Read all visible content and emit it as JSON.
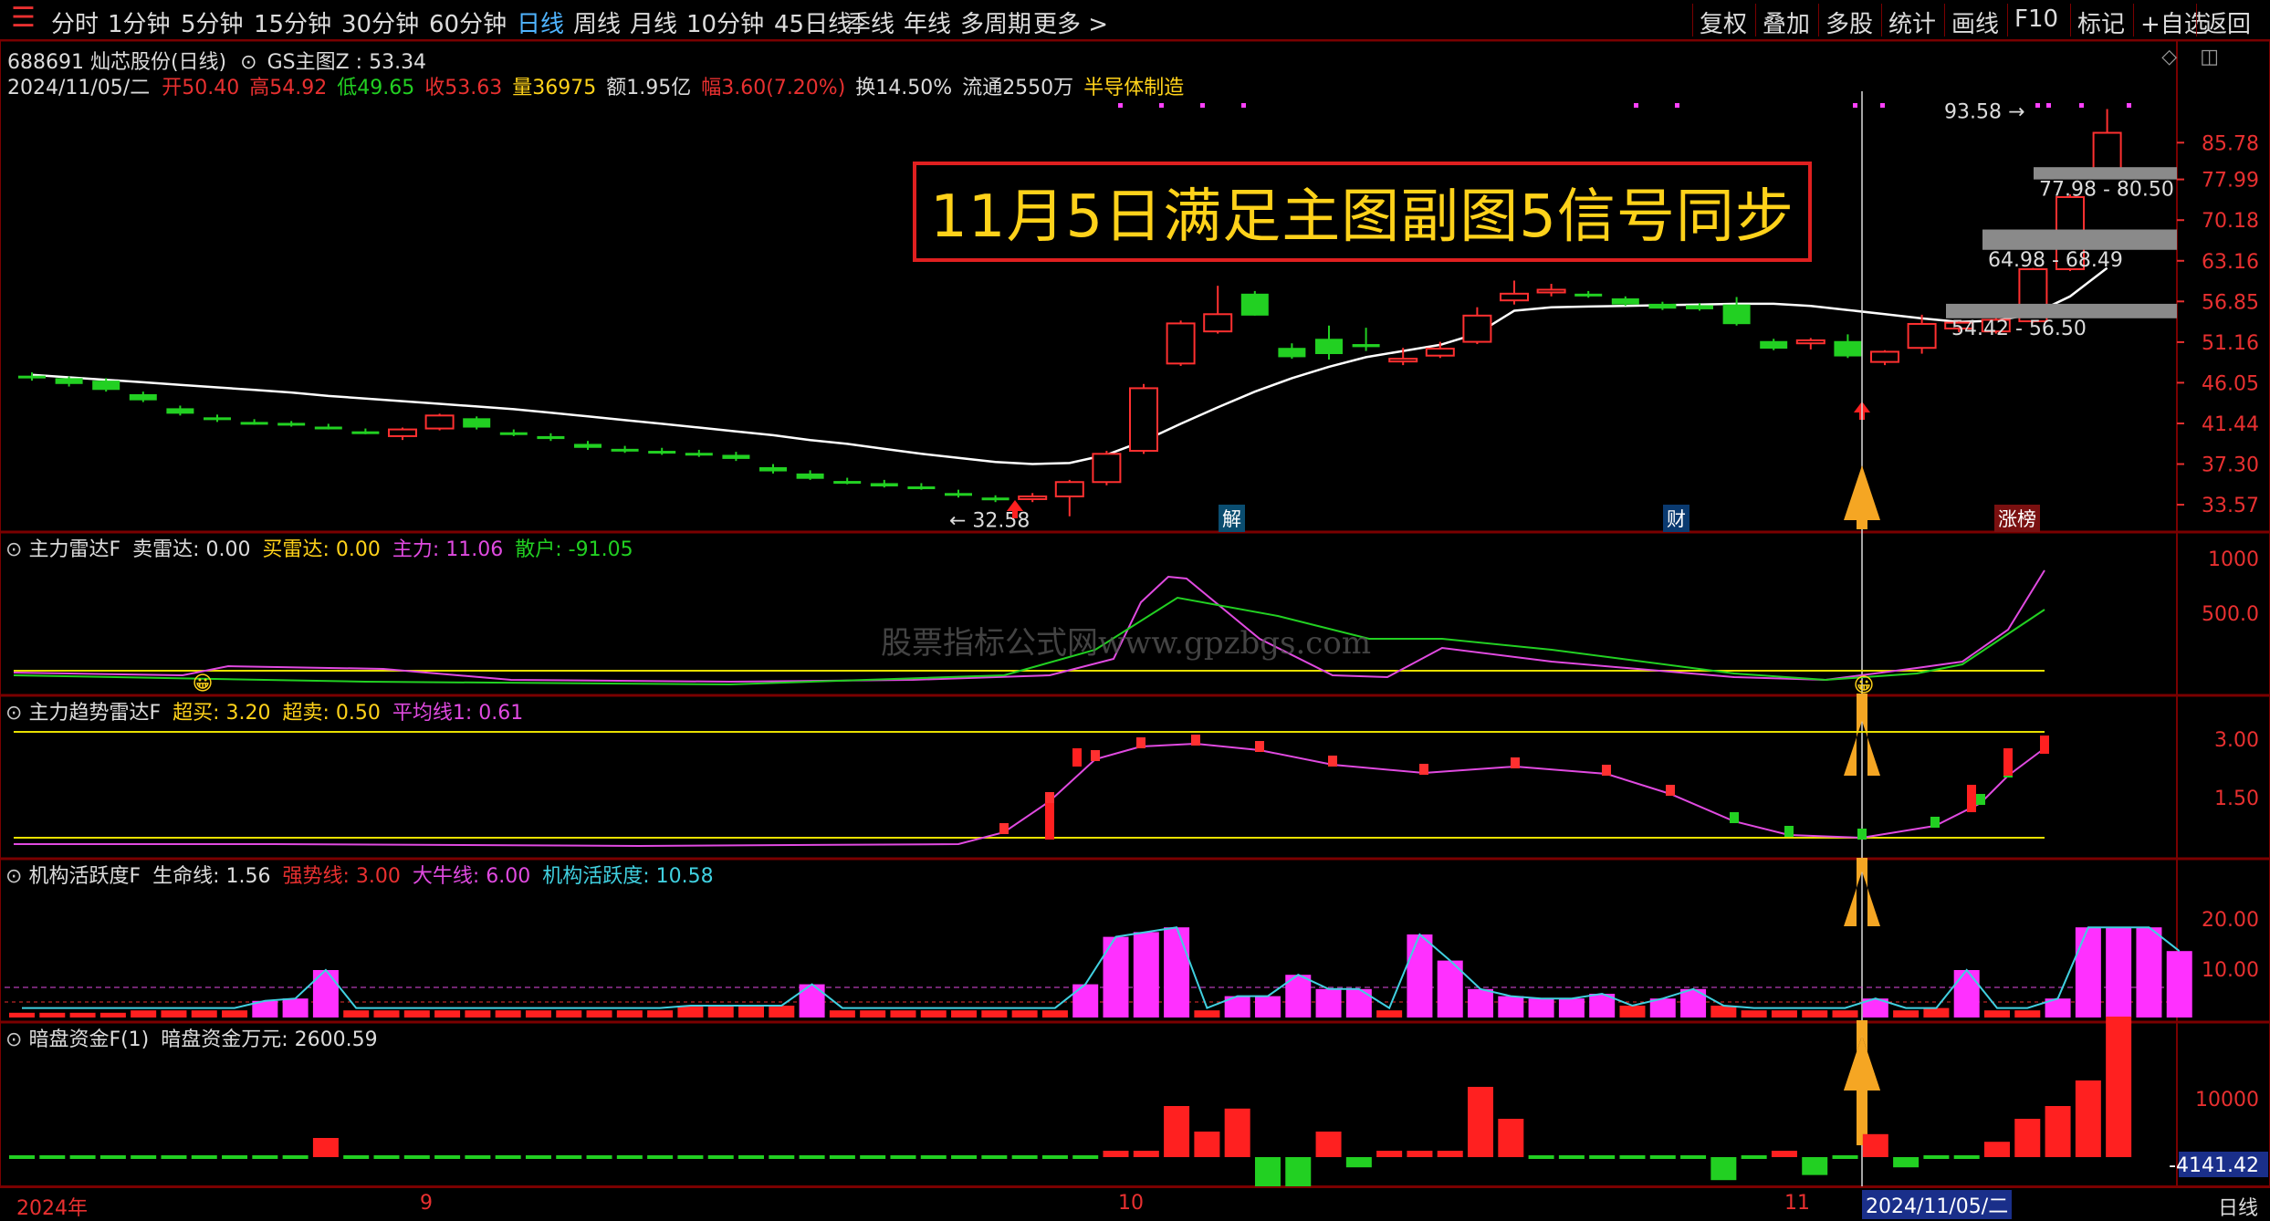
{
  "toolbar": {
    "periods": [
      "分时",
      "1分钟",
      "5分钟",
      "15分钟",
      "30分钟",
      "60分钟",
      "日线",
      "周线",
      "月线",
      "10分钟",
      "45日线",
      "季线",
      "年线",
      "多周期",
      "更多 >"
    ],
    "active": "日线",
    "right_buttons": [
      "复权",
      "叠加",
      "多股",
      "统计",
      "画线",
      "F10",
      "标记",
      "+自选",
      "返回"
    ]
  },
  "stock": {
    "header_line1": "688691 灿芯股份(日线)",
    "indicator": "GS主图Z : 53.34",
    "date": "2024/11/05/二",
    "open_label": "开",
    "open": "50.40",
    "high_label": "高",
    "high": "54.92",
    "low_label": "低",
    "low": "49.65",
    "close_label": "收",
    "close": "53.63",
    "vol_label": "量",
    "vol": "36975",
    "amt": "额1.95亿",
    "range_label": "幅",
    "range": "3.60(7.20%)",
    "turnover": "换14.50%",
    "float": "流通2550万",
    "industry": "半导体制造"
  },
  "annotation": {
    "title": "11月5日满足主图副图5信号同步",
    "low_price": "32.58",
    "high_price": "93.58",
    "zones": [
      "77.98 - 80.50",
      "64.98 - 68.49",
      "54.42 - 56.50"
    ],
    "badges": [
      "解",
      "财",
      "涨榜"
    ]
  },
  "price_axis": [
    "85.78",
    "77.99",
    "70.18",
    "63.16",
    "56.85",
    "51.16",
    "46.05",
    "41.44",
    "37.30",
    "33.57"
  ],
  "panels": {
    "p1": {
      "name": "主力雷达F",
      "l1": "卖雷达: 0.00",
      "l2": "买雷达: 0.00",
      "l3": "主力: 11.06",
      "l4": "散户: -91.05",
      "axis": [
        "1000",
        "500.0"
      ]
    },
    "p2": {
      "name": "主力趋势雷达F",
      "l1": "超买: 3.20",
      "l2": "超卖: 0.50",
      "l3": "平均线1: 0.61",
      "axis": [
        "3.00",
        "1.50"
      ]
    },
    "p3": {
      "name": "机构活跃度F",
      "l1": "生命线: 1.56",
      "l2": "强势线: 3.00",
      "l3": "大牛线: 6.00",
      "l4": "机构活跃度: 10.58",
      "axis": [
        "20.00",
        "10.00"
      ]
    },
    "p4": {
      "name": "暗盘资金F(1)",
      "l1": "暗盘资金万元: 2600.59",
      "axis": [
        "10000",
        "-4141.42"
      ]
    }
  },
  "watermark": "股票指标公式网www.gpzbgs.com",
  "dates": {
    "d1": "2024年",
    "d2": "9",
    "d3": "10",
    "d4": "11",
    "d5": "2024/11/05/二",
    "period": "日线"
  },
  "chart_data": {
    "type": "candlestick",
    "candles": [
      [
        46.9,
        47.3,
        46.3,
        46.6
      ],
      [
        46.6,
        46.8,
        45.6,
        45.9
      ],
      [
        46.3,
        46.6,
        45.0,
        45.2
      ],
      [
        44.7,
        45.0,
        43.8,
        44.0
      ],
      [
        43.1,
        43.4,
        42.3,
        42.5
      ],
      [
        42.1,
        42.4,
        41.6,
        41.8
      ],
      [
        41.6,
        41.9,
        41.3,
        41.5
      ],
      [
        41.5,
        41.7,
        41.1,
        41.3
      ],
      [
        41.1,
        41.4,
        40.8,
        41.0
      ],
      [
        40.6,
        40.9,
        40.3,
        40.5
      ],
      [
        40.1,
        41.0,
        39.7,
        40.8
      ],
      [
        40.9,
        42.5,
        40.7,
        42.3
      ],
      [
        42.0,
        42.2,
        40.8,
        41.0
      ],
      [
        40.5,
        40.8,
        40.1,
        40.3
      ],
      [
        40.1,
        40.4,
        39.6,
        39.8
      ],
      [
        39.3,
        39.6,
        38.7,
        38.9
      ],
      [
        38.8,
        39.1,
        38.4,
        38.6
      ],
      [
        38.6,
        38.9,
        38.2,
        38.4
      ],
      [
        38.4,
        38.7,
        38.0,
        38.2
      ],
      [
        38.2,
        38.5,
        37.6,
        37.8
      ],
      [
        37.0,
        37.3,
        36.4,
        36.6
      ],
      [
        36.4,
        36.7,
        35.8,
        35.9
      ],
      [
        35.7,
        36.0,
        35.4,
        35.6
      ],
      [
        35.5,
        35.8,
        35.1,
        35.2
      ],
      [
        35.2,
        35.5,
        34.9,
        35.0
      ],
      [
        34.6,
        34.9,
        34.2,
        34.4
      ],
      [
        34.2,
        34.4,
        33.8,
        34.0
      ],
      [
        34.1,
        34.6,
        33.8,
        34.3
      ],
      [
        34.3,
        35.8,
        32.58,
        35.6
      ],
      [
        35.6,
        38.6,
        35.3,
        38.3
      ],
      [
        38.6,
        45.9,
        38.3,
        45.4
      ],
      [
        48.4,
        54.1,
        48.1,
        53.7
      ],
      [
        52.6,
        59.2,
        52.3,
        55.0
      ],
      [
        58.0,
        58.4,
        54.8,
        54.8
      ],
      [
        50.4,
        51.0,
        49.0,
        49.2
      ],
      [
        51.6,
        53.4,
        48.9,
        49.6
      ],
      [
        50.9,
        53.1,
        50.0,
        50.5
      ],
      [
        48.7,
        50.4,
        48.2,
        49.0
      ],
      [
        49.4,
        51.2,
        49.1,
        50.3
      ],
      [
        51.2,
        56.0,
        50.9,
        54.8
      ],
      [
        57.0,
        60.0,
        56.4,
        58.0
      ],
      [
        58.2,
        59.5,
        57.6,
        58.6
      ],
      [
        58.0,
        58.4,
        57.4,
        57.6
      ],
      [
        57.3,
        57.6,
        56.2,
        56.4
      ],
      [
        56.5,
        56.8,
        55.6,
        55.8
      ],
      [
        56.3,
        56.6,
        55.5,
        55.7
      ],
      [
        56.4,
        57.5,
        53.4,
        53.6
      ],
      [
        51.3,
        51.6,
        50.1,
        50.3
      ],
      [
        51.0,
        51.7,
        50.2,
        51.4
      ],
      [
        51.3,
        52.2,
        49.1,
        49.3
      ],
      [
        48.6,
        50.1,
        48.2,
        49.9
      ],
      [
        50.4,
        54.92,
        49.65,
        53.63
      ],
      [
        53.0,
        54.0,
        52.5,
        53.8
      ],
      [
        52.6,
        54.5,
        52.3,
        54.2
      ],
      [
        54.0,
        62.0,
        53.8,
        61.8
      ],
      [
        61.8,
        75.0,
        61.5,
        74.5
      ],
      [
        80.0,
        93.58,
        79.5,
        88.0
      ]
    ],
    "ma_line": [
      47.0,
      46.7,
      46.4,
      46.1,
      45.8,
      45.5,
      45.2,
      44.9,
      44.5,
      44.2,
      43.9,
      43.6,
      43.3,
      43.0,
      42.6,
      42.2,
      41.8,
      41.4,
      41.0,
      40.6,
      40.2,
      39.7,
      39.3,
      38.8,
      38.3,
      37.9,
      37.5,
      37.3,
      37.4,
      38.2,
      39.6,
      41.4,
      43.2,
      45.0,
      46.6,
      48.0,
      49.2,
      50.0,
      50.8,
      52.3,
      55.5,
      56.0,
      56.1,
      56.2,
      56.3,
      56.4,
      56.5,
      56.5,
      56.2,
      55.6,
      55.0,
      54.4,
      53.9,
      54.1,
      55.0,
      57.6,
      62.0
    ]
  }
}
